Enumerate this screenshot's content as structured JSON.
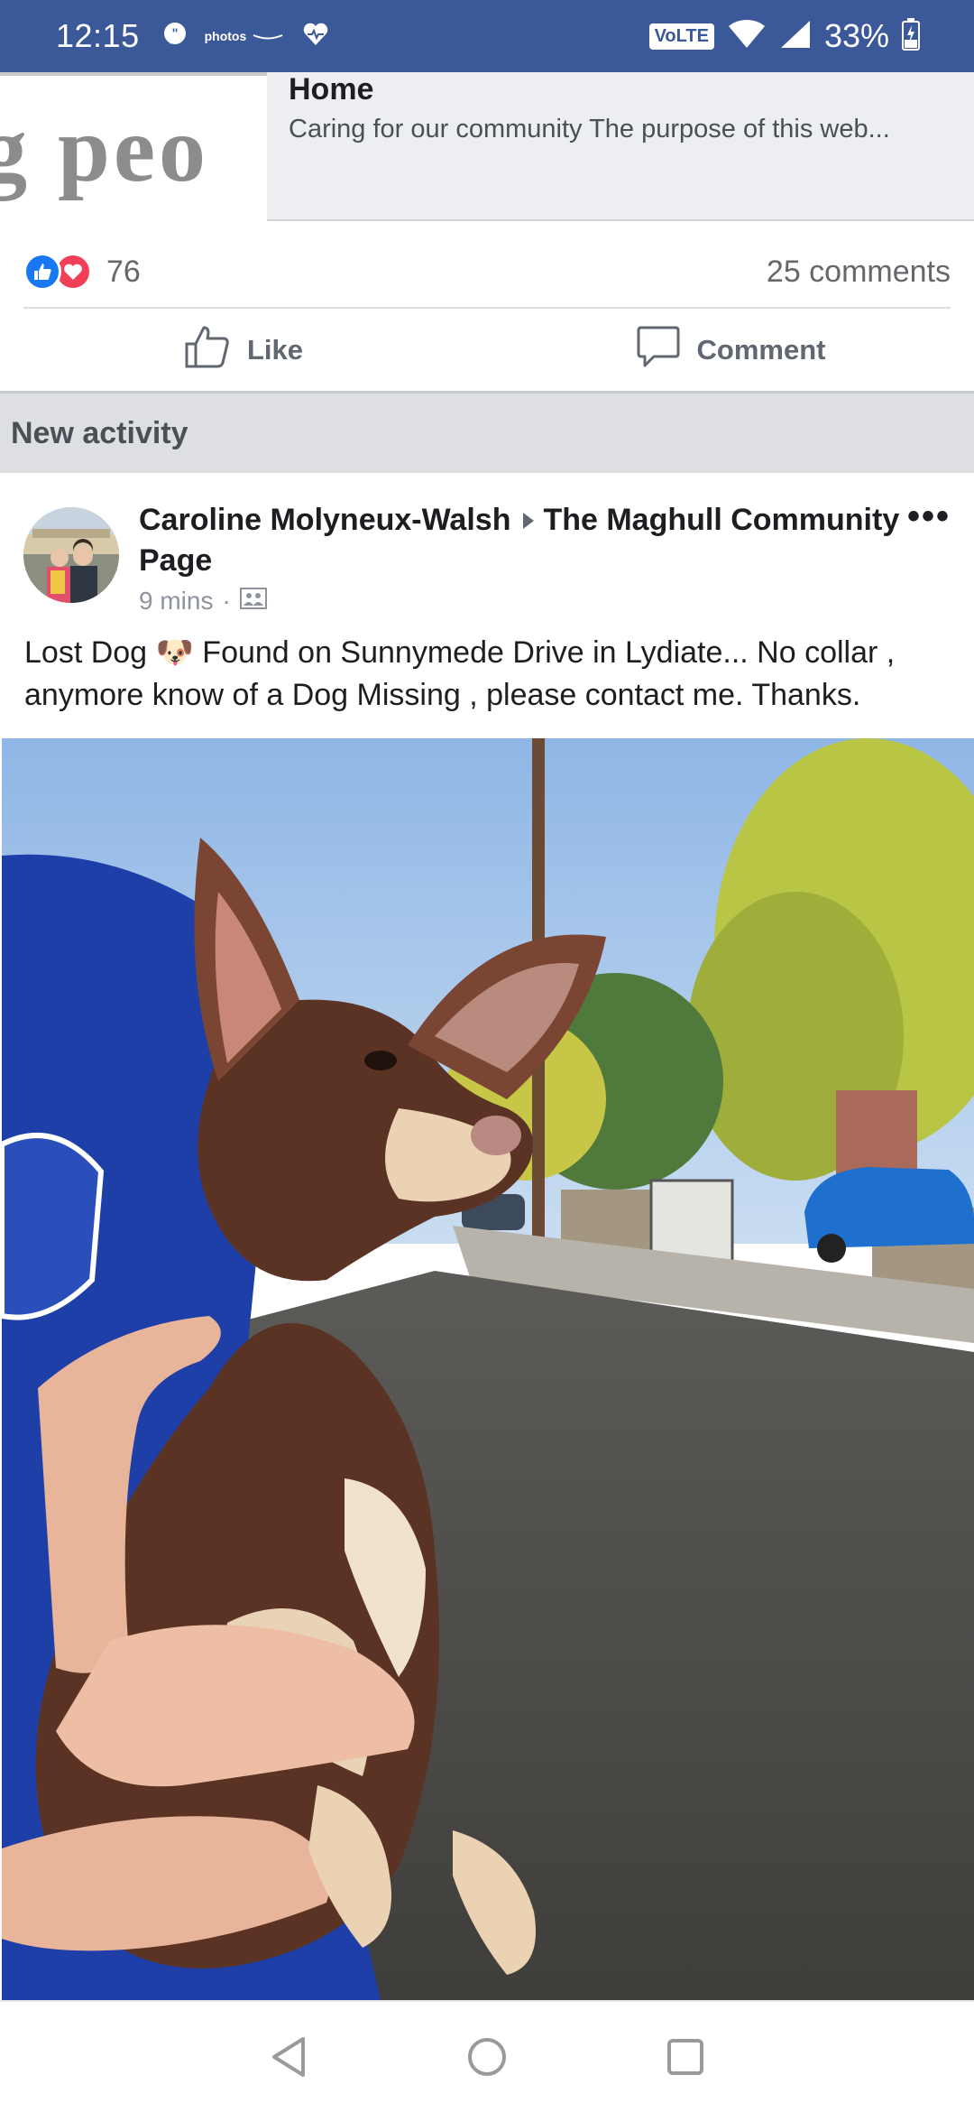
{
  "status_bar": {
    "time": "12:15",
    "photos_label": "photos",
    "network_badge": "VoLTE",
    "battery": "33%",
    "icons": [
      "chat-bubble-icon",
      "amazon-photos-icon",
      "heart-health-icon",
      "wifi-icon",
      "cell-signal-icon",
      "battery-charging-icon"
    ]
  },
  "link_preview": {
    "thumbnail_text": "g peo",
    "title": "Home",
    "description": "Caring for our community The purpose of this web..."
  },
  "reactions": {
    "count": "76",
    "comments": "25 comments"
  },
  "actions": {
    "like_label": "Like",
    "comment_label": "Comment"
  },
  "section": {
    "title": "New activity"
  },
  "post": {
    "author": "Caroline Molyneux-Walsh",
    "group": "The Maghull Community Page",
    "time": "9 mins",
    "text": "Lost Dog 🐶 Found on Sunnymede Drive in Lydiate... No collar , anymore know of a Dog Missing , please contact me. Thanks."
  },
  "navigation": {
    "icons": [
      "back-icon",
      "home-icon",
      "recents-icon"
    ]
  },
  "colors": {
    "brand": "#3b5998",
    "like_blue": "#1877f2",
    "love_red": "#f33e58",
    "muted_text": "#65676b"
  }
}
